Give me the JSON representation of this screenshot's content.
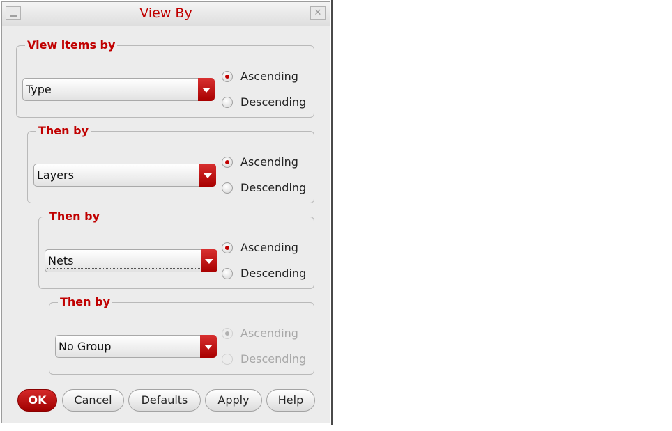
{
  "window": {
    "title": "View By",
    "close_glyph": "✕"
  },
  "groups": [
    {
      "legend": "View items by",
      "value": "Type",
      "ascending_label": "Ascending",
      "descending_label": "Descending",
      "selected": "Ascending",
      "enabled": true
    },
    {
      "legend": "Then by",
      "value": "Layers",
      "ascending_label": "Ascending",
      "descending_label": "Descending",
      "selected": "Ascending",
      "enabled": true
    },
    {
      "legend": "Then by",
      "value": "Nets",
      "ascending_label": "Ascending",
      "descending_label": "Descending",
      "selected": "Ascending",
      "enabled": true
    },
    {
      "legend": "Then by",
      "value": "No Group",
      "ascending_label": "Ascending",
      "descending_label": "Descending",
      "selected": "Ascending",
      "enabled": false
    }
  ],
  "buttons": {
    "ok": "OK",
    "cancel": "Cancel",
    "defaults": "Defaults",
    "apply": "Apply",
    "help": "Help"
  },
  "colors": {
    "accent": "#c00000",
    "background": "#ececec"
  }
}
